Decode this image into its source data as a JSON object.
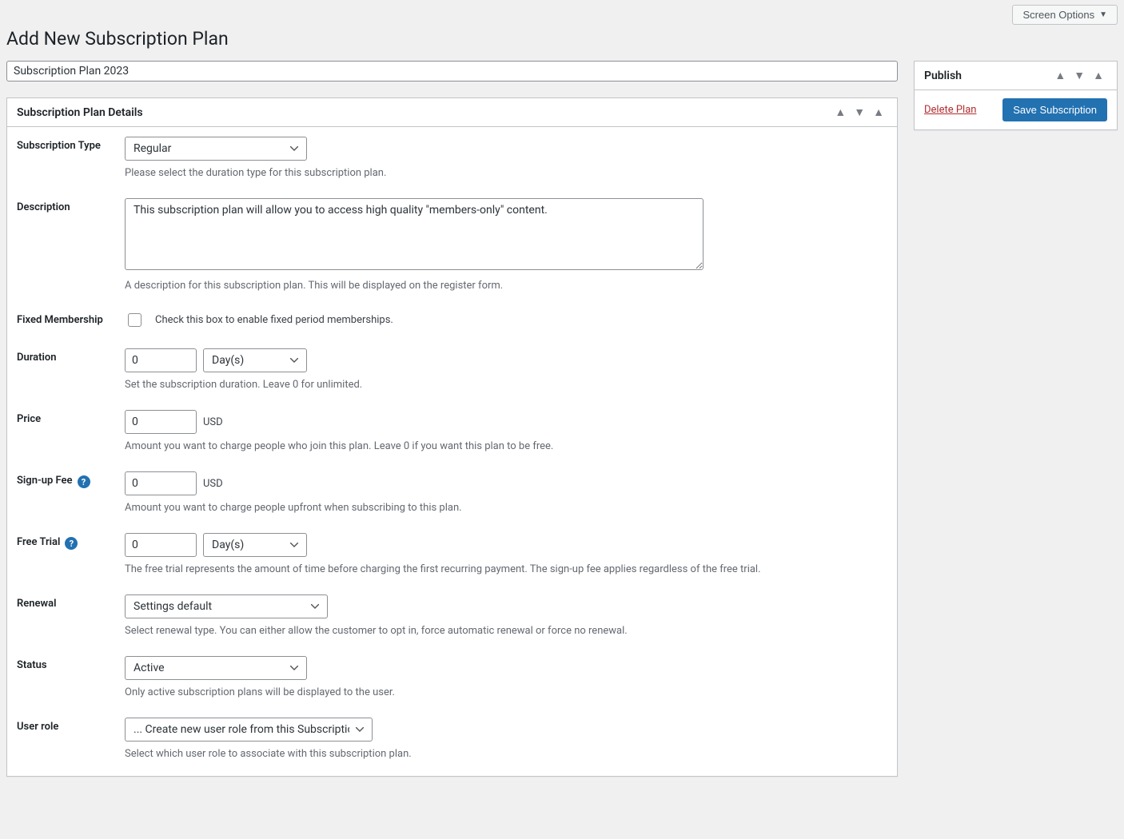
{
  "screen_options_label": "Screen Options",
  "page_title": "Add New Subscription Plan",
  "plan_title": "Subscription Plan 2023",
  "details_box": {
    "heading": "Subscription Plan Details",
    "subscription_type": {
      "label": "Subscription Type",
      "value": "Regular",
      "help": "Please select the duration type for this subscription plan."
    },
    "description": {
      "label": "Description",
      "value": "This subscription plan will allow you to access high quality \"members-only\" content.",
      "help": "A description for this subscription plan. This will be displayed on the register form."
    },
    "fixed_membership": {
      "label": "Fixed Membership",
      "checkbox_label": "Check this box to enable fixed period memberships."
    },
    "duration": {
      "label": "Duration",
      "value": "0",
      "unit": "Day(s)",
      "help": "Set the subscription duration. Leave 0 for unlimited."
    },
    "price": {
      "label": "Price",
      "value": "0",
      "currency": "USD",
      "help": "Amount you want to charge people who join this plan. Leave 0 if you want this plan to be free."
    },
    "signup_fee": {
      "label": "Sign-up Fee",
      "value": "0",
      "currency": "USD",
      "help": "Amount you want to charge people upfront when subscribing to this plan."
    },
    "free_trial": {
      "label": "Free Trial",
      "value": "0",
      "unit": "Day(s)",
      "help": "The free trial represents the amount of time before charging the first recurring payment. The sign-up fee applies regardless of the free trial."
    },
    "renewal": {
      "label": "Renewal",
      "value": "Settings default",
      "help": "Select renewal type. You can either allow the customer to opt in, force automatic renewal or force no renewal."
    },
    "status": {
      "label": "Status",
      "value": "Active",
      "help": "Only active subscription plans will be displayed to the user."
    },
    "user_role": {
      "label": "User role",
      "value": "... Create new user role from this Subscription Plan",
      "help": "Select which user role to associate with this subscription plan."
    }
  },
  "publish_box": {
    "heading": "Publish",
    "delete_label": "Delete Plan",
    "save_label": "Save Subscription"
  }
}
